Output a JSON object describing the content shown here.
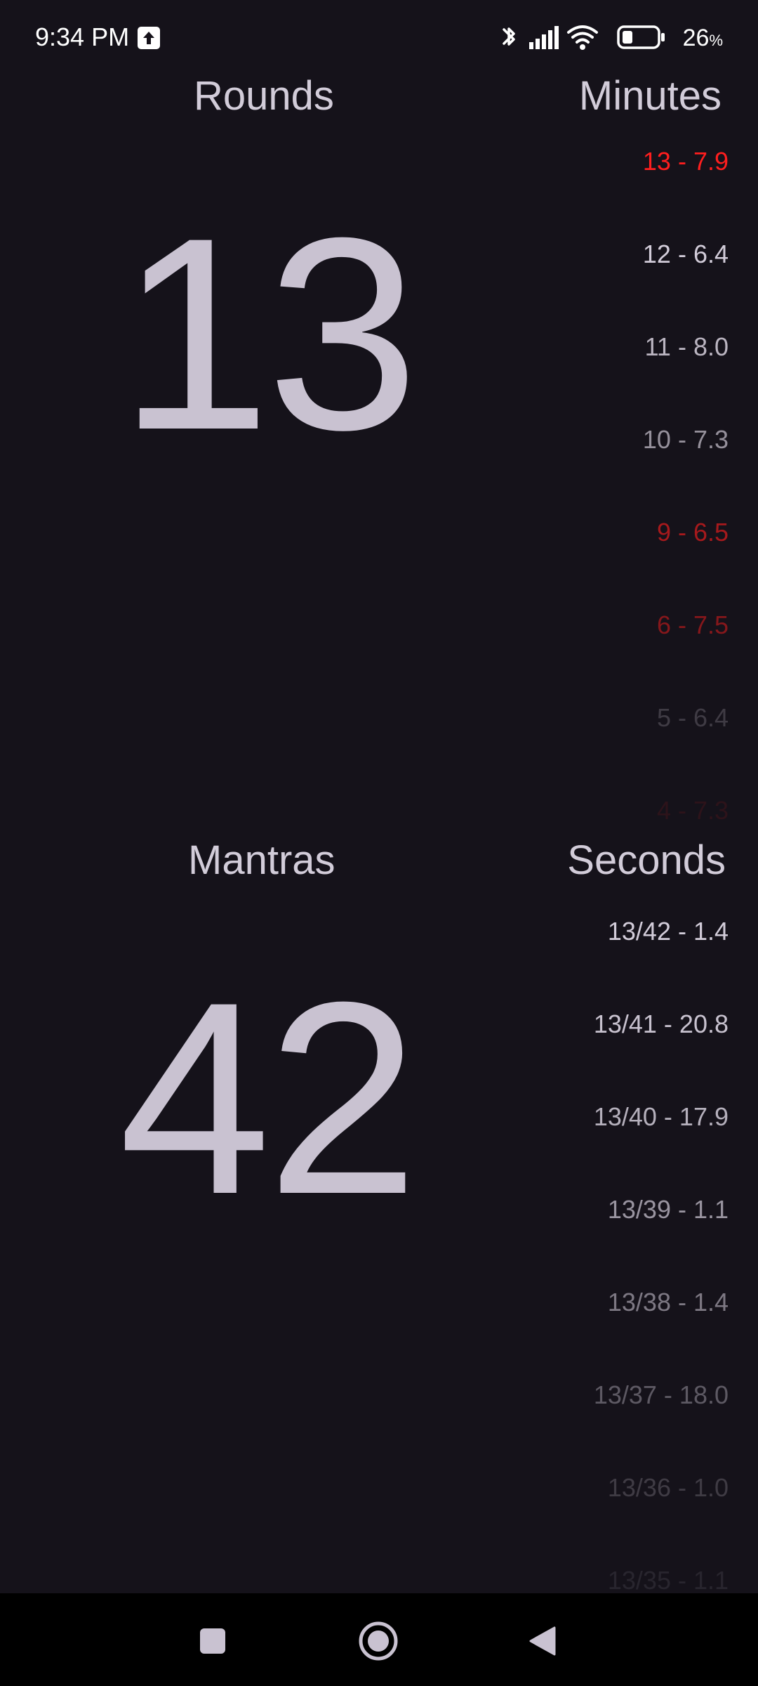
{
  "status_bar": {
    "time": "9:34 PM",
    "battery_percent": "26",
    "battery_percent_sign": "%",
    "icons": [
      "upload-notification-icon",
      "bluetooth-icon",
      "signal-icon",
      "wifi-icon",
      "battery-icon"
    ]
  },
  "rounds": {
    "header": "Rounds",
    "value": "13"
  },
  "minutes": {
    "header": "Minutes",
    "items": [
      {
        "text": "13 - 7.9",
        "color": "#ff1e1e",
        "opacity": 1.0
      },
      {
        "text": "12 - 6.4",
        "color": "#d2ccd9",
        "opacity": 1.0
      },
      {
        "text": "11 - 8.0",
        "color": "#d2ccd9",
        "opacity": 0.88
      },
      {
        "text": "10 - 7.3",
        "color": "#d2ccd9",
        "opacity": 0.68
      },
      {
        "text": "9 - 6.5",
        "color": "#ff1e1e",
        "opacity": 0.62
      },
      {
        "text": "6 - 7.5",
        "color": "#ff1e1e",
        "opacity": 0.48
      },
      {
        "text": "5 - 6.4",
        "color": "#d2ccd9",
        "opacity": 0.22
      },
      {
        "text": "4 - 7.3",
        "color": "#ff1e1e",
        "opacity": 0.1
      }
    ]
  },
  "mantras": {
    "header": "Mantras",
    "value": "42"
  },
  "seconds": {
    "header": "Seconds",
    "items": [
      {
        "text": "13/42 - 1.4",
        "color": "#d2ccd9",
        "opacity": 1.0
      },
      {
        "text": "13/41 - 20.8",
        "color": "#d2ccd9",
        "opacity": 0.95
      },
      {
        "text": "13/40 - 17.9",
        "color": "#d2ccd9",
        "opacity": 0.85
      },
      {
        "text": "13/39 - 1.1",
        "color": "#d2ccd9",
        "opacity": 0.7
      },
      {
        "text": "13/38 - 1.4",
        "color": "#d2ccd9",
        "opacity": 0.55
      },
      {
        "text": "13/37 - 18.0",
        "color": "#d2ccd9",
        "opacity": 0.38
      },
      {
        "text": "13/36 - 1.0",
        "color": "#d2ccd9",
        "opacity": 0.22
      },
      {
        "text": "13/35 - 1.1",
        "color": "#d2ccd9",
        "opacity": 0.1
      }
    ]
  },
  "nav_bar": {
    "buttons": [
      "recents-button",
      "home-button",
      "back-button"
    ],
    "color": "#c9c2d1"
  }
}
